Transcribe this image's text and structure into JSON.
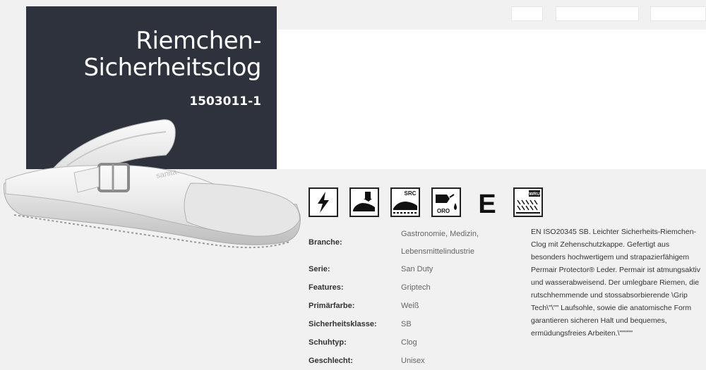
{
  "product": {
    "title_line1": "Riemchen-",
    "title_line2": "Sicherheitsclog",
    "article_number": "1503011-1"
  },
  "icons": [
    {
      "name": "antistatic-icon"
    },
    {
      "name": "toecap-icon"
    },
    {
      "name": "src-slip-icon",
      "label": "SRC"
    },
    {
      "name": "oro-oil-resistant-icon",
      "label": "ORO"
    },
    {
      "name": "energy-absorption-e-icon",
      "label": "E"
    },
    {
      "name": "wru-water-icon",
      "label": "WRU"
    }
  ],
  "specs": {
    "branche": {
      "label": "Branche:",
      "value_line1": "Gastronomie, Medizin,",
      "value_line2": "Lebensmittelindustrie"
    },
    "serie": {
      "label": "Serie:",
      "value": "San Duty"
    },
    "features": {
      "label": "Features:",
      "value": "Griptech"
    },
    "primaerfarbe": {
      "label": "Primärfarbe:",
      "value": "Weiß"
    },
    "sicherheitsklasse": {
      "label": "Sicherheitsklasse:",
      "value": "SB"
    },
    "schuhtyp": {
      "label": "Schuhtyp:",
      "value": "Clog"
    },
    "geschlecht": {
      "label": "Geschlecht:",
      "value": "Unisex"
    }
  },
  "description": "EN ISO20345 SB. Leichter Sicherheits-Riemchen-Clog mit Zehenschutzkappe. Gefertigt aus besonders hochwertigem und strapazierfähigem Permair Protector® Leder. Permair ist atmungsaktiv und wasserabweisend. Der umlegbare Riemen, die rutschhemmende und stossabsorbierende \\Grip Tech\\\"\\\"\" Laufsohle, sowie die anatomische Form garantieren sicheren Halt und bequemes, ermüdungsfreies Arbeiten.\\\"\"\"\"\"",
  "shoe_brand_text": "sanita",
  "colors": {
    "hero_bg": "#2e323d",
    "page_bg": "#f1f1f1"
  }
}
